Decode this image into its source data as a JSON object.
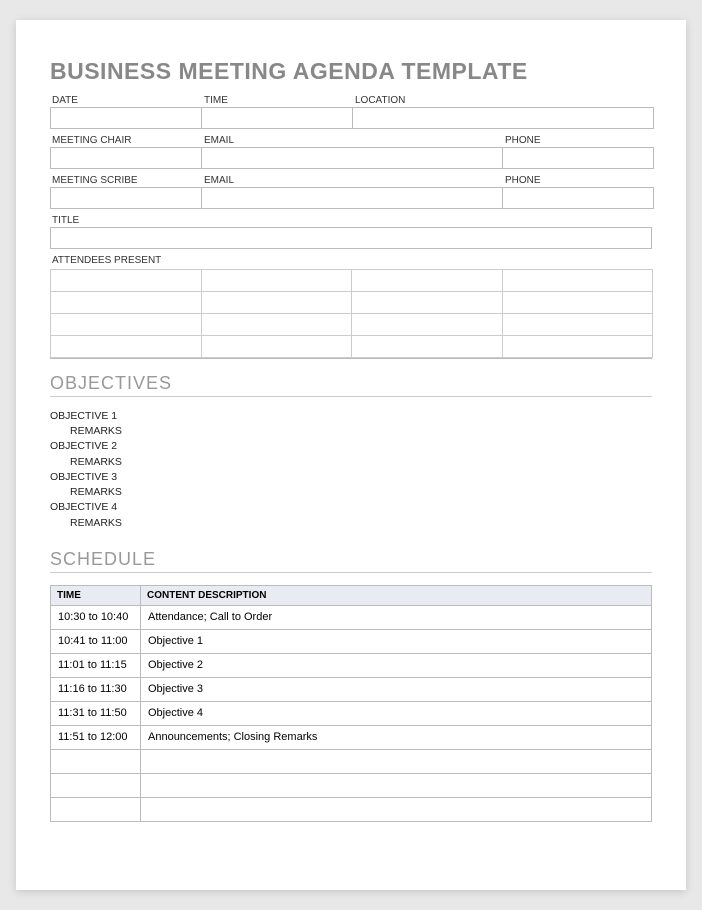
{
  "title": "BUSINESS MEETING AGENDA TEMPLATE",
  "fields": {
    "row1": [
      {
        "label": "DATE",
        "cls": "f1",
        "value": ""
      },
      {
        "label": "TIME",
        "cls": "f2",
        "value": ""
      },
      {
        "label": "LOCATION",
        "cls": "f3",
        "value": ""
      }
    ],
    "row2": [
      {
        "label": "MEETING CHAIR",
        "cls": "f4",
        "value": ""
      },
      {
        "label": "EMAIL",
        "cls": "f5",
        "value": ""
      },
      {
        "label": "PHONE",
        "cls": "f4",
        "value": ""
      }
    ],
    "row3": [
      {
        "label": "MEETING SCRIBE",
        "cls": "f4",
        "value": ""
      },
      {
        "label": "EMAIL",
        "cls": "f5",
        "value": ""
      },
      {
        "label": "PHONE",
        "cls": "f4",
        "value": ""
      }
    ],
    "row4": [
      {
        "label": "TITLE",
        "cls": "full",
        "value": ""
      }
    ],
    "attendees_label": "ATTENDEES PRESENT"
  },
  "sections": {
    "objectives_heading": "OBJECTIVES",
    "schedule_heading": "SCHEDULE"
  },
  "objectives": [
    {
      "objective": "OBJECTIVE 1",
      "remarks": "REMARKS"
    },
    {
      "objective": "OBJECTIVE 2",
      "remarks": "REMARKS"
    },
    {
      "objective": "OBJECTIVE 3",
      "remarks": "REMARKS"
    },
    {
      "objective": "OBJECTIVE 4",
      "remarks": "REMARKS"
    }
  ],
  "schedule": {
    "headers": {
      "time": "TIME",
      "content": "CONTENT DESCRIPTION"
    },
    "rows": [
      {
        "time": "10:30 to 10:40",
        "content": "Attendance; Call to Order"
      },
      {
        "time": "10:41 to 11:00",
        "content": "Objective 1"
      },
      {
        "time": "11:01 to 11:15",
        "content": "Objective 2"
      },
      {
        "time": "11:16 to 11:30",
        "content": "Objective 3"
      },
      {
        "time": "11:31 to 11:50",
        "content": "Objective 4"
      },
      {
        "time": "11:51 to 12:00",
        "content": "Announcements; Closing Remarks"
      },
      {
        "time": "",
        "content": ""
      },
      {
        "time": "",
        "content": ""
      },
      {
        "time": "",
        "content": ""
      }
    ]
  }
}
